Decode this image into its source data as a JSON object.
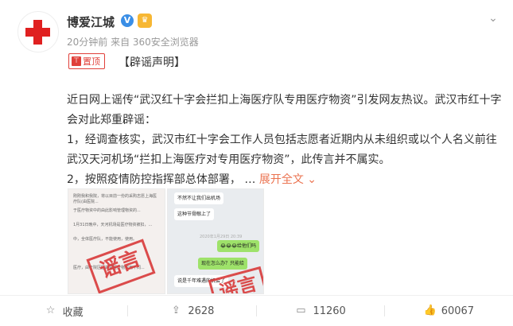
{
  "post": {
    "username": "博爱江城",
    "verified_badge": "V",
    "meta": "20分钟前 来自 360安全浏览器",
    "pin_label": "置顶",
    "tag": "【辟谣声明】",
    "paragraphs": [
      "近日网上谣传“武汉红十字会拦扣上海医疗队专用医疗物资”引发网友热议。武汉市红十字会对此郑重辟谣：",
      "1，经调查核实，武汉市红十字会工作人员包括志愿者近期内从未组织或以个人名义前往武汉天河机场“拦扣上海医疗对专用医疗物资”，此传言并不属实。"
    ],
    "paragraph3": "2，按照疫情防控指挥部总体部署，",
    "expand_label": "展开全文",
    "ellipsis": "…"
  },
  "images": {
    "stamp_text": "谣言",
    "chat": {
      "msg1": "不然不让我们出机场",
      "msg2": "这种节骨眼上了",
      "time": "2020年1月29日 20:39",
      "msg3": "😂😂😂给他们吗",
      "msg4": "现在怎么办？只能给",
      "msg5": "说是千年难遇的机会了"
    },
    "doc_lines": [
      "刚刚我和我院，将以目前一份的采购志愿上海医疗队(由医院...",
      "于医疗物资中的由此影响管理物资的...",
      "1月31日晚中，天河机场是医疗物资被扣，...",
      "中，全体医疗队，不能使用，使用。",
      "医疗，由于院区区的是医疗物资用不同..."
    ]
  },
  "footer": {
    "collect": "收藏",
    "repost": "2628",
    "comment": "11260",
    "like": "60067"
  }
}
